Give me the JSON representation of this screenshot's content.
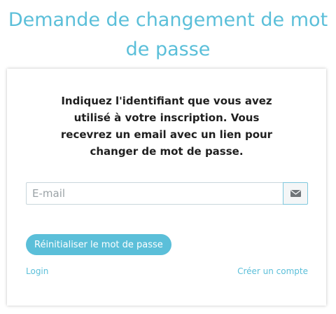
{
  "page": {
    "title": "Demande de changement de mot de passe"
  },
  "form": {
    "instructions": "Indiquez l'identifiant que vous avez utilisé à votre inscription. Vous recevrez un email avec un lien pour changer de mot de passe.",
    "email_placeholder": "E-mail",
    "email_value": "",
    "email_icon": "envelope-icon",
    "reset_button_label": "Réinitialiser le mot de passe"
  },
  "links": {
    "login": "Login",
    "create_account": "Créer un compte"
  },
  "colors": {
    "accent": "#5bbfd9",
    "text": "#1f1f1f"
  }
}
